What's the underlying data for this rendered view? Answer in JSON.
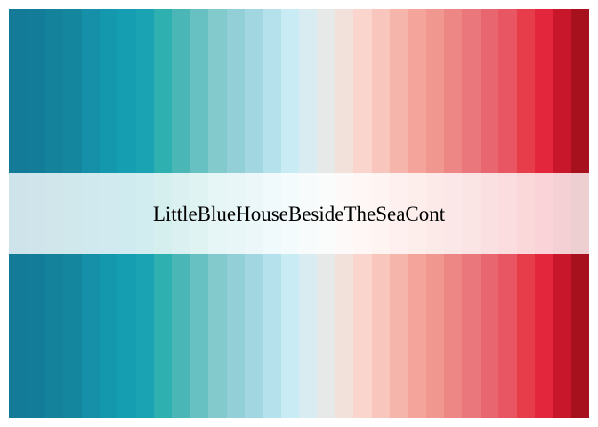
{
  "palette": {
    "name": "LittleBlueHouseBesideTheSeaCont",
    "colors": [
      "#137a97",
      "#137d99",
      "#14829b",
      "#14879e",
      "#1690a8",
      "#1498ae",
      "#159db2",
      "#1aa3b3",
      "#2eb0b1",
      "#4ab6b6",
      "#67c1c2",
      "#82cacc",
      "#92cfd6",
      "#a2d7e2",
      "#b4e1ec",
      "#c9ecf4",
      "#d8ecf1",
      "#e6e9e8",
      "#f2e0da",
      "#fad5cd",
      "#f8c6bd",
      "#f5b5ab",
      "#f4a49a",
      "#f0978f",
      "#ec8785",
      "#ea777b",
      "#e8666f",
      "#e85563",
      "#e73c49",
      "#e4263c",
      "#c8172b",
      "#a7111e"
    ]
  }
}
